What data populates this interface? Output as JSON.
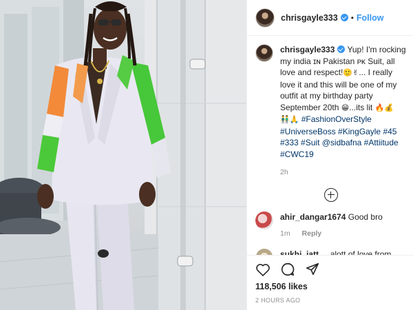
{
  "post": {
    "username": "chrisgayle333",
    "follow_separator": "•",
    "follow_label": "Follow",
    "caption": {
      "username": "chrisgayle333",
      "text_1": "Yup! I'm rocking my india ɪɴ Pakistan ᴘᴋ Suit, all love and respect!",
      "emoji_1": "🙂✌",
      "text_2": "... I really love it and this will be one of my outfit at my birthday party September 20th",
      "emoji_2": "😁",
      "text_3": "...its lit",
      "emoji_3": "🔥💰",
      "emoji_4": "👬🙏",
      "hashtags": [
        "#FashionOverStyle",
        "#UniverseBoss",
        "#KingGayle",
        "#45",
        "#333",
        "#Suit",
        "@sidbafna",
        "#Attiitude",
        "#CWC19"
      ],
      "timestamp": "2h"
    },
    "comments": [
      {
        "username": "ahir_dangar1674",
        "text": "Good bro",
        "time": "1m",
        "reply_label": "Reply"
      },
      {
        "username": "sukhi_jatt__",
        "text": "alott of love from both countries boss",
        "emoji": "🙏🙏❤❤"
      }
    ],
    "likes": "118,506 likes",
    "posted": "2 HOURS AGO",
    "icons": [
      "heart-icon",
      "comment-icon",
      "share-icon"
    ],
    "colors": {
      "accent": "#3897f0",
      "text": "#262626",
      "muted": "#8e8e8e",
      "hashtag": "#003569"
    }
  }
}
